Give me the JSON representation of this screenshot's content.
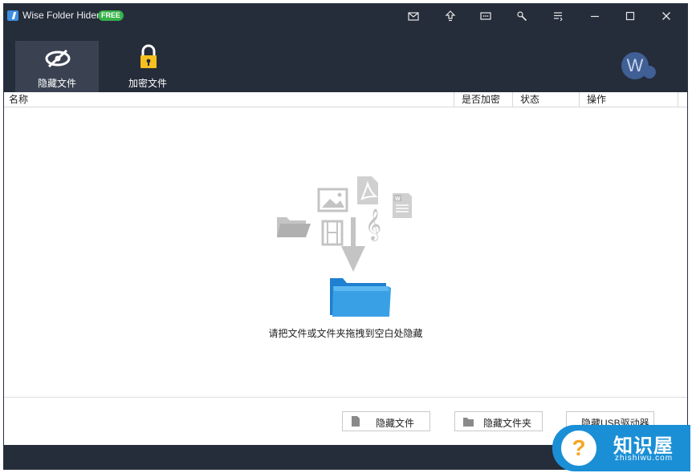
{
  "app": {
    "title": "Wise Folder Hider",
    "badge": "FREE"
  },
  "titlebar_icons": [
    "mail-icon",
    "upgrade-icon",
    "feedback-icon",
    "settings-icon",
    "menu-icon",
    "minimize-icon",
    "maximize-icon",
    "close-icon"
  ],
  "tabs": [
    {
      "label": "隐藏文件",
      "icon": "eye-slash-icon",
      "active": true
    },
    {
      "label": "加密文件",
      "icon": "lock-icon",
      "active": false
    }
  ],
  "user": {
    "avatar_letter": "W"
  },
  "table": {
    "columns": [
      "名称",
      "是否加密",
      "状态",
      "操作"
    ]
  },
  "content": {
    "drop_hint": "请把文件或文件夹拖拽到空白处隐藏"
  },
  "actions": {
    "hide_file": "隐藏文件",
    "hide_folder": "隐藏文件夹",
    "hide_usb": "隐藏USB驱动器"
  },
  "watermark": {
    "text": "知识屋",
    "sub": "zhishiwu.com"
  },
  "colors": {
    "header_bg": "#252c3a",
    "tab_active_bg": "#3a4252",
    "badge_green": "#36b24a",
    "folder_blue": "#3aa0e6",
    "watermark_blue": "#1a8fd6"
  }
}
